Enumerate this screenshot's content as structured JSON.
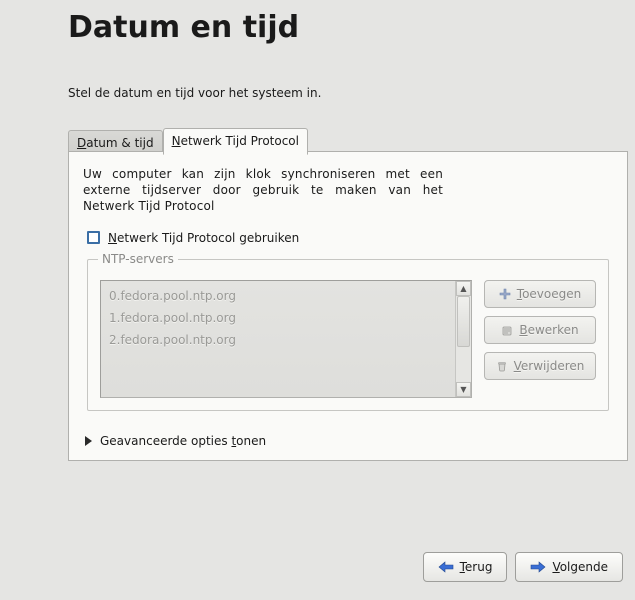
{
  "title": "Datum en tijd",
  "subtitle": "Stel de datum en tijd voor het systeem in.",
  "tabs": {
    "datum": {
      "ul": "D",
      "rest": "atum & tijd"
    },
    "ntp": {
      "ul": "N",
      "rest": "etwerk Tijd Protocol"
    }
  },
  "panel": {
    "description": "Uw computer kan zijn klok synchroniseren met een externe tijdserver door gebruik te maken van het Netwerk Tijd Protocol",
    "checkbox": {
      "ul": "N",
      "rest": "etwerk Tijd Protocol gebruiken"
    },
    "group_legend": "NTP-servers",
    "servers": [
      "0.fedora.pool.ntp.org",
      "1.fedora.pool.ntp.org",
      "2.fedora.pool.ntp.org"
    ],
    "buttons": {
      "add": {
        "ul": "T",
        "rest": "oevoegen"
      },
      "edit": {
        "ul": "B",
        "rest": "ewerken"
      },
      "remove": {
        "ul": "V",
        "rest": "erwijderen"
      }
    },
    "advanced": {
      "pre": "Geavanceerde opties ",
      "ul": "t",
      "post": "onen"
    }
  },
  "nav": {
    "back": {
      "ul": "T",
      "rest": "erug"
    },
    "next": {
      "ul": "V",
      "rest": "olgende"
    }
  }
}
